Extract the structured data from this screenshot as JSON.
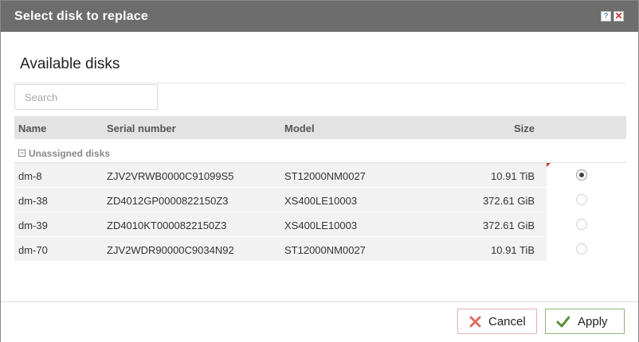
{
  "window": {
    "title": "Select disk to replace",
    "help_glyph": "?",
    "close_glyph": "✕"
  },
  "section": {
    "title": "Available disks"
  },
  "search": {
    "placeholder": "Search"
  },
  "columns": {
    "name": "Name",
    "serial": "Serial number",
    "model": "Model",
    "size": "Size"
  },
  "group": {
    "toggle": "−",
    "label": "Unassigned disks"
  },
  "rows": [
    {
      "name": "dm-8",
      "serial": "ZJV2VRWB0000C91099S5",
      "model": "ST12000NM0027",
      "size": "10.91 TiB",
      "selected": true
    },
    {
      "name": "dm-38",
      "serial": "ZD4012GP0000822150Z3",
      "model": "XS400LE10003",
      "size": "372.61 GiB",
      "selected": false
    },
    {
      "name": "dm-39",
      "serial": "ZD4010KT0000822150Z3",
      "model": "XS400LE10003",
      "size": "372.61 GiB",
      "selected": false
    },
    {
      "name": "dm-70",
      "serial": "ZJV2WDR90000C9034N92",
      "model": "ST12000NM0027",
      "size": "10.91 TiB",
      "selected": false
    }
  ],
  "buttons": {
    "cancel": "Cancel",
    "apply": "Apply",
    "cancel_icon": "x-icon",
    "apply_icon": "checkmark-icon"
  },
  "colors": {
    "titlebar": "#6d6d6d",
    "cancel_icon": "#e06b5f",
    "apply_icon": "#5a8f3c"
  }
}
